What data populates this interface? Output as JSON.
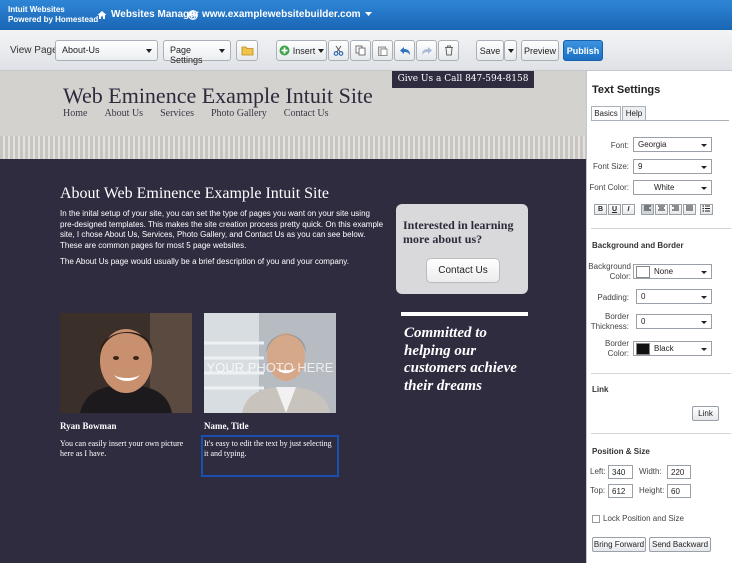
{
  "topbar": {
    "brand_line1": "Intuit Websites",
    "brand_line2": "Powered by Homestead",
    "websites_manager": "Websites Manager",
    "site_url": "www.examplewebsitebuilder.com"
  },
  "toolbar": {
    "view_page_label": "View Page:",
    "view_page_value": "About-Us",
    "page_settings": "Page Settings",
    "insert": "Insert",
    "save": "Save",
    "preview": "Preview",
    "publish": "Publish"
  },
  "site": {
    "call_bar": "Give Us a Call 847-594-8158",
    "title": "Web Eminence Example Intuit Site",
    "nav": [
      "Home",
      "About Us",
      "Services",
      "Photo Gallery",
      "Contact Us"
    ],
    "about_title": "About Web Eminence Example Intuit Site",
    "about_paragraph": "In the inital setup of your site, you can set the type of pages you want on your site using pre-designed templates. This makes the site creation process pretty quick. On this example site, I chose About Us, Services, Photo Gallery, and Contact Us as you can see below. These are common pages for most 5 page websites.",
    "about_paragraph2": "The About Us page would usually be a brief description of you and your company.",
    "cta_text": "Interested in learning more about us?",
    "cta_button": "Contact Us",
    "photo2_overlay": "YOUR PHOTO HERE",
    "person1_name": "Ryan Bowman",
    "person1_desc": "You can easily insert your own picture here as I have.",
    "person2_name": "Name, Title",
    "person2_desc": "It's easy to edit the text by just selecting it and typing.",
    "motto": "Committed to helping our customers achieve their dreams"
  },
  "panel": {
    "title": "Text Settings",
    "tabs": [
      "Basics",
      "Help"
    ],
    "font_label": "Font:",
    "font_value": "Georgia",
    "font_size_label": "Font Size:",
    "font_size_value": "9",
    "font_color_label": "Font Color:",
    "font_color_value": "White",
    "format_buttons": [
      "B",
      "U",
      "I"
    ],
    "bg_border_heading": "Background and Border",
    "bg_color_label": "Background Color:",
    "bg_color_value": "None",
    "padding_label": "Padding:",
    "padding_value": "0",
    "border_thickness_label": "Border Thickness:",
    "border_thickness_value": "0",
    "border_color_label": "Border Color:",
    "border_color_value": "Black",
    "link_heading": "Link",
    "link_button": "Link",
    "pos_heading": "Position & Size",
    "left_label": "Left:",
    "left_value": "340",
    "width_label": "Width:",
    "width_value": "220",
    "top_label": "Top:",
    "top_value": "612",
    "height_label": "Height:",
    "height_value": "60",
    "lock_label": "Lock Position and Size",
    "bring_forward": "Bring Forward",
    "send_backward": "Send Backward"
  },
  "colors": {
    "topbar": "#1a66b5",
    "canvas_bg": "#2f2c40",
    "publish": "#1b6fc4"
  }
}
